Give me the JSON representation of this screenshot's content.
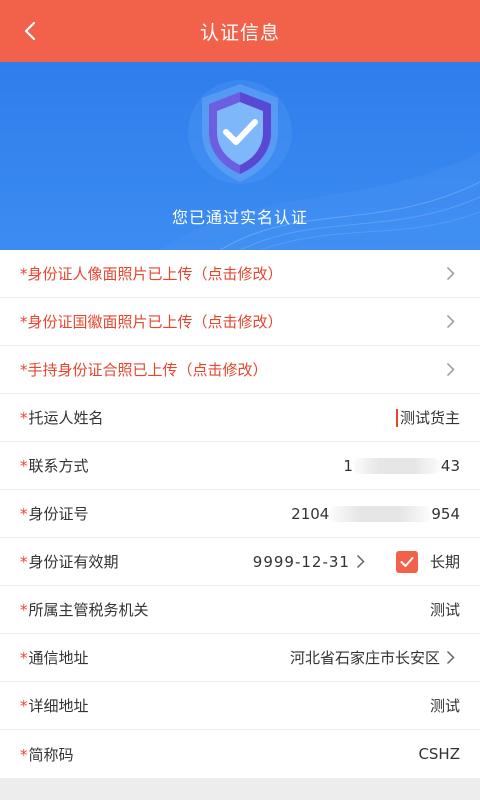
{
  "header": {
    "title": "认证信息",
    "back_icon": "chevron-left-icon"
  },
  "banner": {
    "status_text": "您已通过实名认证",
    "icon": "verified-shield-icon"
  },
  "uploads": [
    {
      "label": "身份证人像面照片已上传（点击修改）"
    },
    {
      "label": "身份证国徽面照片已上传（点击修改）"
    },
    {
      "label": "手持身份证合照已上传（点击修改）"
    }
  ],
  "fields": {
    "shipper_name": {
      "label": "托运人姓名",
      "value": "测试货主"
    },
    "contact": {
      "label": "联系方式",
      "value_start": "1",
      "value_end": "43"
    },
    "id_number": {
      "label": "身份证号",
      "value_start": "2104",
      "value_end": "954"
    },
    "id_validity": {
      "label": "身份证有效期",
      "value": "9999-12-31",
      "long_term_label": "长期",
      "long_term_checked": true
    },
    "tax_office": {
      "label": "所属主管税务机关",
      "value": "测试"
    },
    "address": {
      "label": "通信地址",
      "value": "河北省石家庄市长安区"
    },
    "detail_address": {
      "label": "详细地址",
      "value": "测试"
    },
    "short_code": {
      "label": "简称码",
      "value": "CSHZ"
    }
  },
  "required_mark": "*",
  "colors": {
    "header": "#f2624a",
    "banner": "#2f7dec",
    "accent_red": "#e8452f"
  }
}
